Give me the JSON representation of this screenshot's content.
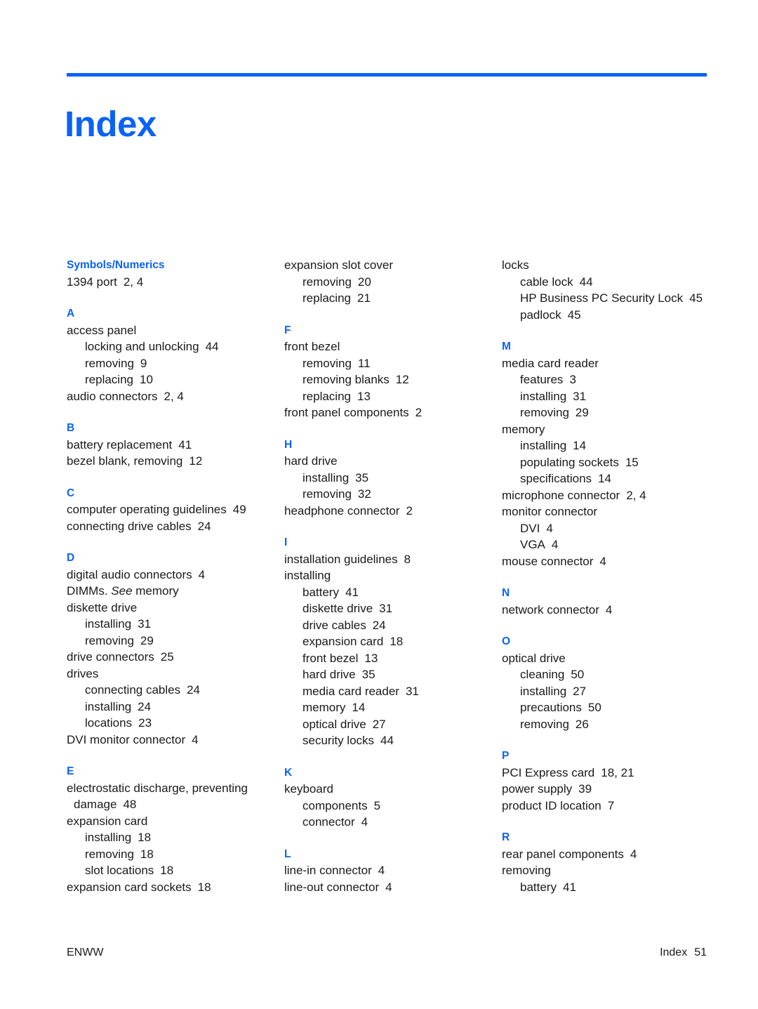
{
  "document": {
    "title": "Index",
    "accent_color": "#0b63f6",
    "text_color": "#1a1a1a"
  },
  "footer": {
    "left": "ENWW",
    "right_label": "Index",
    "right_page": "51"
  },
  "columns": [
    {
      "id": "column-1",
      "sections": [
        {
          "letter": "Symbols/Numerics",
          "entries": [
            {
              "level": 1,
              "text": "1394 port",
              "pages": "2,  4"
            }
          ]
        },
        {
          "letter": "A",
          "entries": [
            {
              "level": 1,
              "text": "access panel",
              "pages": ""
            },
            {
              "level": 2,
              "text": "locking and unlocking",
              "pages": "44"
            },
            {
              "level": 2,
              "text": "removing",
              "pages": "9"
            },
            {
              "level": 2,
              "text": "replacing",
              "pages": "10"
            },
            {
              "level": 1,
              "text": "audio connectors",
              "pages": "2,  4"
            }
          ]
        },
        {
          "letter": "B",
          "entries": [
            {
              "level": 1,
              "text": "battery replacement",
              "pages": "41"
            },
            {
              "level": 1,
              "text": "bezel blank, removing",
              "pages": "12"
            }
          ]
        },
        {
          "letter": "C",
          "entries": [
            {
              "level": 1,
              "text": "computer operating guidelines",
              "pages": "49"
            },
            {
              "level": 1,
              "text": "connecting drive cables",
              "pages": "24"
            }
          ]
        },
        {
          "letter": "D",
          "entries": [
            {
              "level": 1,
              "text": "digital audio connectors",
              "pages": "4"
            },
            {
              "level": 1,
              "text": "DIMMs. See memory",
              "pages": "",
              "italic_word": "See"
            },
            {
              "level": 1,
              "text": "diskette drive",
              "pages": ""
            },
            {
              "level": 2,
              "text": "installing",
              "pages": "31"
            },
            {
              "level": 2,
              "text": "removing",
              "pages": "29"
            },
            {
              "level": 1,
              "text": "drive connectors",
              "pages": "25"
            },
            {
              "level": 1,
              "text": "drives",
              "pages": ""
            },
            {
              "level": 2,
              "text": "connecting cables",
              "pages": "24"
            },
            {
              "level": 2,
              "text": "installing",
              "pages": "24"
            },
            {
              "level": 2,
              "text": "locations",
              "pages": "23"
            },
            {
              "level": 1,
              "text": "DVI monitor connector",
              "pages": "4"
            }
          ]
        },
        {
          "letter": "E",
          "entries": [
            {
              "level": 1,
              "text": "electrostatic discharge, preventing damage",
              "pages": "48"
            },
            {
              "level": 1,
              "text": "expansion card",
              "pages": ""
            },
            {
              "level": 2,
              "text": "installing",
              "pages": "18"
            },
            {
              "level": 2,
              "text": "removing",
              "pages": "18"
            },
            {
              "level": 2,
              "text": "slot locations",
              "pages": "18"
            },
            {
              "level": 1,
              "text": "expansion card sockets",
              "pages": "18"
            }
          ]
        }
      ]
    },
    {
      "id": "column-2",
      "sections": [
        {
          "letter": "",
          "entries": [
            {
              "level": 1,
              "text": "expansion slot cover",
              "pages": ""
            },
            {
              "level": 2,
              "text": "removing",
              "pages": "20"
            },
            {
              "level": 2,
              "text": "replacing",
              "pages": "21"
            }
          ]
        },
        {
          "letter": "F",
          "entries": [
            {
              "level": 1,
              "text": "front bezel",
              "pages": ""
            },
            {
              "level": 2,
              "text": "removing",
              "pages": "11"
            },
            {
              "level": 2,
              "text": "removing blanks",
              "pages": "12"
            },
            {
              "level": 2,
              "text": "replacing",
              "pages": "13"
            },
            {
              "level": 1,
              "text": "front panel components",
              "pages": "2"
            }
          ]
        },
        {
          "letter": "H",
          "entries": [
            {
              "level": 1,
              "text": "hard drive",
              "pages": ""
            },
            {
              "level": 2,
              "text": "installing",
              "pages": "35"
            },
            {
              "level": 2,
              "text": "removing",
              "pages": "32"
            },
            {
              "level": 1,
              "text": "headphone connector",
              "pages": "2"
            }
          ]
        },
        {
          "letter": "I",
          "entries": [
            {
              "level": 1,
              "text": "installation guidelines",
              "pages": "8"
            },
            {
              "level": 1,
              "text": "installing",
              "pages": ""
            },
            {
              "level": 2,
              "text": "battery",
              "pages": "41"
            },
            {
              "level": 2,
              "text": "diskette drive",
              "pages": "31"
            },
            {
              "level": 2,
              "text": "drive cables",
              "pages": "24"
            },
            {
              "level": 2,
              "text": "expansion card",
              "pages": "18"
            },
            {
              "level": 2,
              "text": "front bezel",
              "pages": "13"
            },
            {
              "level": 2,
              "text": "hard drive",
              "pages": "35"
            },
            {
              "level": 2,
              "text": "media card reader",
              "pages": "31"
            },
            {
              "level": 2,
              "text": "memory",
              "pages": "14"
            },
            {
              "level": 2,
              "text": "optical drive",
              "pages": "27"
            },
            {
              "level": 2,
              "text": "security locks",
              "pages": "44"
            }
          ]
        },
        {
          "letter": "K",
          "entries": [
            {
              "level": 1,
              "text": "keyboard",
              "pages": ""
            },
            {
              "level": 2,
              "text": "components",
              "pages": "5"
            },
            {
              "level": 2,
              "text": "connector",
              "pages": "4"
            }
          ]
        },
        {
          "letter": "L",
          "entries": [
            {
              "level": 1,
              "text": "line-in connector",
              "pages": "4"
            },
            {
              "level": 1,
              "text": "line-out connector",
              "pages": "4"
            }
          ]
        }
      ]
    },
    {
      "id": "column-3",
      "sections": [
        {
          "letter": "",
          "entries": [
            {
              "level": 1,
              "text": "locks",
              "pages": ""
            },
            {
              "level": 2,
              "text": "cable lock",
              "pages": "44"
            },
            {
              "level": 2,
              "text": "HP Business PC Security Lock",
              "pages": "45"
            },
            {
              "level": 2,
              "text": "padlock",
              "pages": "45"
            }
          ]
        },
        {
          "letter": "M",
          "entries": [
            {
              "level": 1,
              "text": "media card reader",
              "pages": ""
            },
            {
              "level": 2,
              "text": "features",
              "pages": "3"
            },
            {
              "level": 2,
              "text": "installing",
              "pages": "31"
            },
            {
              "level": 2,
              "text": "removing",
              "pages": "29"
            },
            {
              "level": 1,
              "text": "memory",
              "pages": ""
            },
            {
              "level": 2,
              "text": "installing",
              "pages": "14"
            },
            {
              "level": 2,
              "text": "populating sockets",
              "pages": "15"
            },
            {
              "level": 2,
              "text": "specifications",
              "pages": "14"
            },
            {
              "level": 1,
              "text": "microphone connector",
              "pages": "2,  4"
            },
            {
              "level": 1,
              "text": "monitor connector",
              "pages": ""
            },
            {
              "level": 2,
              "text": "DVI",
              "pages": "4"
            },
            {
              "level": 2,
              "text": "VGA",
              "pages": "4"
            },
            {
              "level": 1,
              "text": "mouse connector",
              "pages": "4"
            }
          ]
        },
        {
          "letter": "N",
          "entries": [
            {
              "level": 1,
              "text": "network connector",
              "pages": "4"
            }
          ]
        },
        {
          "letter": "O",
          "entries": [
            {
              "level": 1,
              "text": "optical drive",
              "pages": ""
            },
            {
              "level": 2,
              "text": "cleaning",
              "pages": "50"
            },
            {
              "level": 2,
              "text": "installing",
              "pages": "27"
            },
            {
              "level": 2,
              "text": "precautions",
              "pages": "50"
            },
            {
              "level": 2,
              "text": "removing",
              "pages": "26"
            }
          ]
        },
        {
          "letter": "P",
          "entries": [
            {
              "level": 1,
              "text": "PCI Express card",
              "pages": "18,  21"
            },
            {
              "level": 1,
              "text": "power supply",
              "pages": "39"
            },
            {
              "level": 1,
              "text": "product ID location",
              "pages": "7"
            }
          ]
        },
        {
          "letter": "R",
          "entries": [
            {
              "level": 1,
              "text": "rear panel components",
              "pages": "4"
            },
            {
              "level": 1,
              "text": "removing",
              "pages": ""
            },
            {
              "level": 2,
              "text": "battery",
              "pages": "41"
            }
          ]
        }
      ]
    }
  ]
}
